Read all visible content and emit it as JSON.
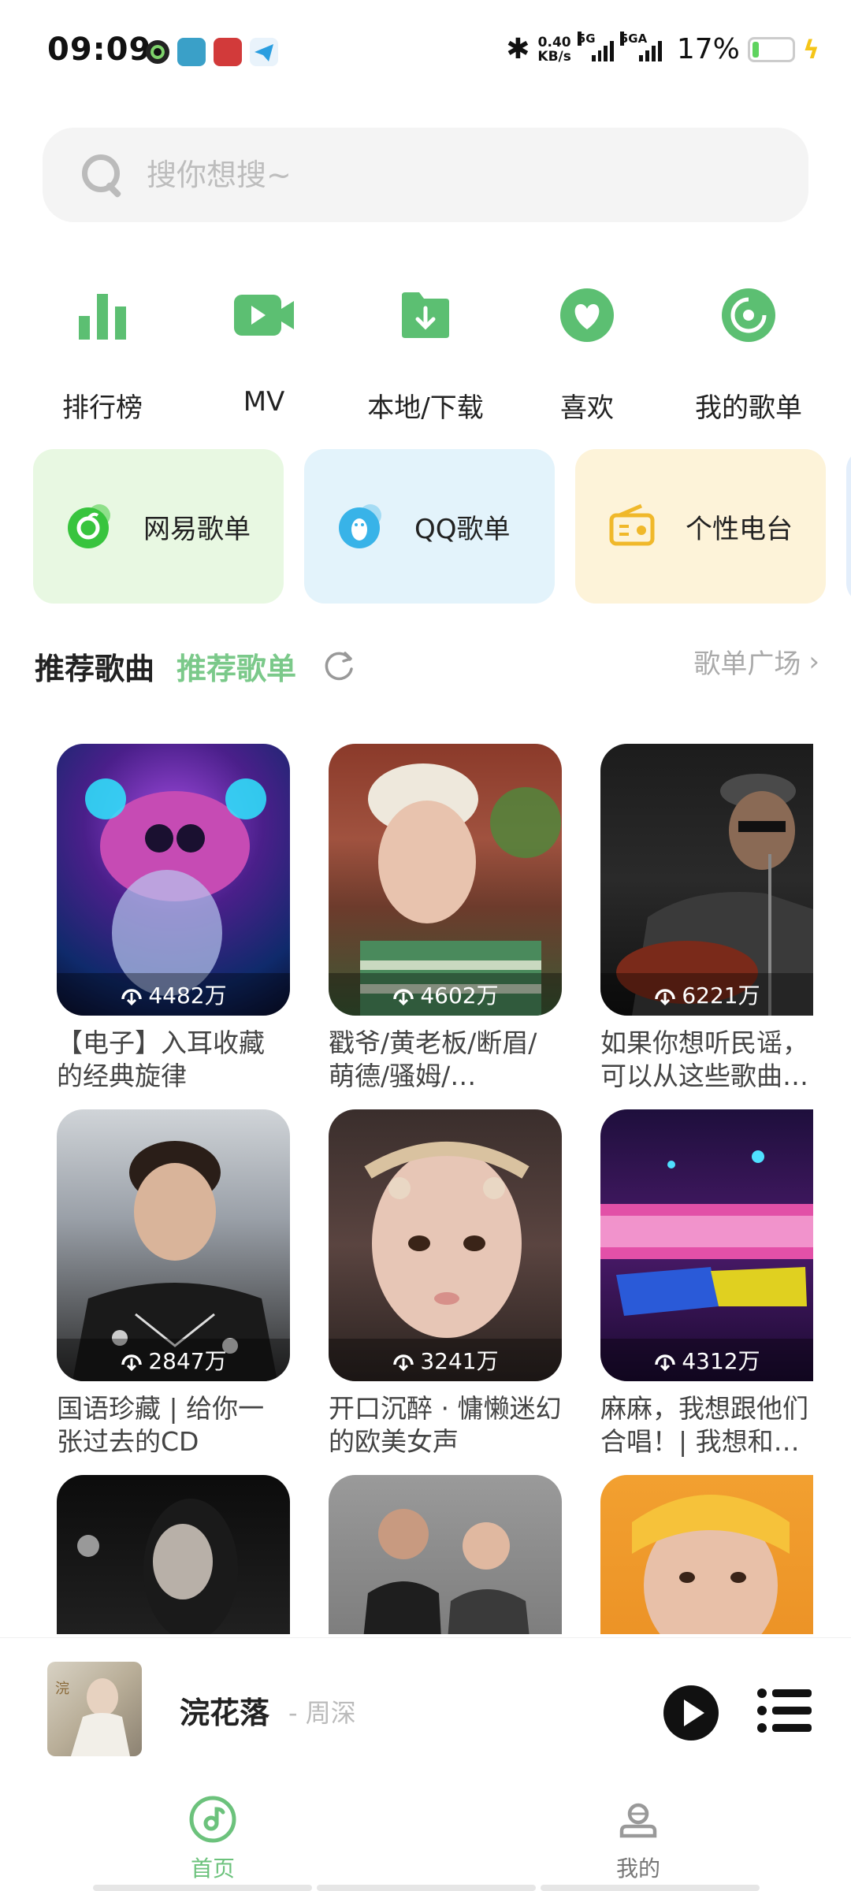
{
  "status_bar": {
    "time": "09:09",
    "net_speed_value": "0.40",
    "net_speed_unit": "KB/s",
    "signal1_label": "5G",
    "signal2_label": "5GA",
    "battery": "17%",
    "battery_level": 0.17
  },
  "search": {
    "placeholder": "搜你想搜~"
  },
  "quick_nav": [
    {
      "label": "排行榜",
      "icon": "chart-bars-icon"
    },
    {
      "label": "MV",
      "icon": "video-camera-icon"
    },
    {
      "label": "本地/下载",
      "icon": "download-folder-icon"
    },
    {
      "label": "喜欢",
      "icon": "heart-icon"
    },
    {
      "label": "我的歌单",
      "icon": "disc-icon"
    }
  ],
  "source_cards": [
    {
      "label": "网易歌单",
      "icon": "netease-icon",
      "bg": "#e8f8e2"
    },
    {
      "label": "QQ歌单",
      "icon": "qq-penguin-icon",
      "bg": "#e3f3fb"
    },
    {
      "label": "个性电台",
      "icon": "radio-icon",
      "bg": "#fdf3d9"
    }
  ],
  "section": {
    "tab_songs": "推荐歌曲",
    "tab_playlists": "推荐歌单",
    "plaza": "歌单广场",
    "chevron": "›"
  },
  "playlists": [
    {
      "count": "4482万",
      "title": "【电子】入耳收藏的经典旋律"
    },
    {
      "count": "4602万",
      "title": "戳爷/黄老板/断眉/萌德/骚姆/…"
    },
    {
      "count": "6221万",
      "title": "如果你想听民谣，可以从这些歌曲…"
    },
    {
      "count": "2847万",
      "title": "国语珍藏 | 给你一张过去的CD"
    },
    {
      "count": "3241万",
      "title": "开口沉醉 · 慵懒迷幻的欧美女声"
    },
    {
      "count": "4312万",
      "title": "麻麻，我想跟他们合唱！| 我想和…"
    },
    {
      "count": "",
      "title": ""
    },
    {
      "count": "",
      "title": ""
    },
    {
      "count": "",
      "title": ""
    }
  ],
  "player": {
    "title": "浣花落",
    "artist": "- 周深"
  },
  "bottom_nav": {
    "home": "首页",
    "me": "我的"
  },
  "colors": {
    "accent_green": "#7bc98a",
    "icon_green": "#5cbf72"
  }
}
